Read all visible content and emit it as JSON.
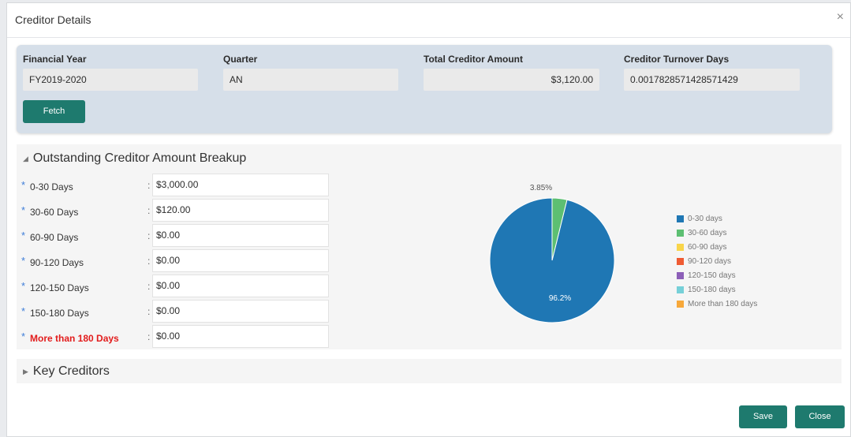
{
  "dialog": {
    "title": "Creditor Details",
    "close_glyph": "×"
  },
  "summary": {
    "fields": [
      {
        "label": "Financial Year",
        "value": "FY2019-2020"
      },
      {
        "label": "Quarter",
        "value": "AN"
      },
      {
        "label": "Total Creditor Amount",
        "value": "$3,120.00"
      },
      {
        "label": "Creditor Turnover Days",
        "value": "0.0017828571428571429"
      }
    ],
    "fetch_label": "Fetch"
  },
  "breakup": {
    "title": "Outstanding Creditor Amount Breakup",
    "rows": [
      {
        "label": "0-30 Days",
        "value": "$3,000.00"
      },
      {
        "label": "30-60 Days",
        "value": "$120.00"
      },
      {
        "label": "60-90 Days",
        "value": "$0.00"
      },
      {
        "label": "90-120 Days",
        "value": "$0.00"
      },
      {
        "label": "120-150 Days",
        "value": "$0.00"
      },
      {
        "label": "150-180 Days",
        "value": "$0.00"
      },
      {
        "label": "More than 180 Days",
        "value": "$0.00"
      }
    ]
  },
  "key_creditors": {
    "title": "Key Creditors"
  },
  "footer": {
    "save_label": "Save",
    "close_label": "Close"
  },
  "colors": {
    "accent": "#1e7a6e",
    "required_asterisk": "#3f7ed8",
    "error_text": "#e21c1c"
  },
  "chart_data": {
    "type": "pie",
    "categories": [
      "0-30 days",
      "30-60 days",
      "60-90 days",
      "90-120 days",
      "120-150 days",
      "150-180 days",
      "More than 180 days"
    ],
    "values": [
      3000,
      120,
      0,
      0,
      0,
      0,
      0
    ],
    "colors": [
      "#1f77b4",
      "#5dbf72",
      "#f9d54a",
      "#ef5b33",
      "#8c5fb8",
      "#76d0d8",
      "#f7a83a"
    ],
    "data_labels": [
      "96.2%",
      "3.85%",
      "",
      "",
      "",
      "",
      ""
    ],
    "legend_position": "right"
  }
}
